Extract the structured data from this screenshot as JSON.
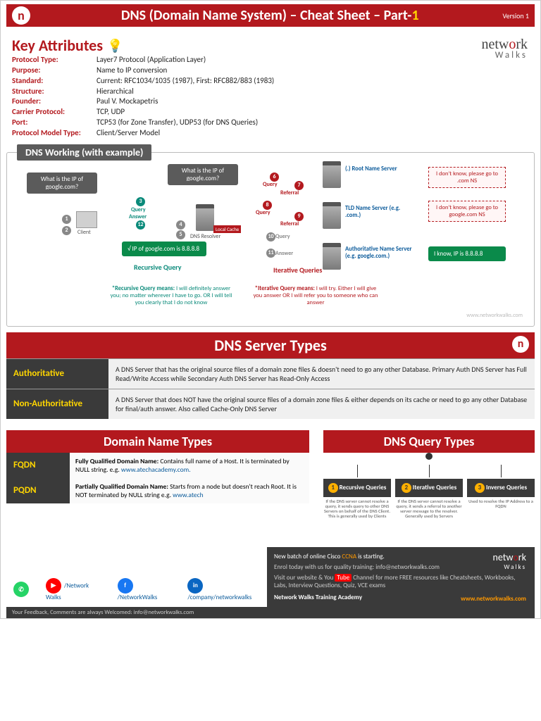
{
  "header": {
    "title_pre": "DNS (Domain Name System) – Cheat Sheet – Part-",
    "title_num": "1",
    "version": "Version 1",
    "logo_letter": "n"
  },
  "brand": {
    "name_pre": "netw",
    "name_o": "o",
    "name_post": "rk",
    "sub": "Walks"
  },
  "key_attributes": {
    "heading": "Key Attributes",
    "rows": [
      {
        "label": "Protocol Type:",
        "value": "Layer7 Protocol (Application Layer)"
      },
      {
        "label": "Purpose:",
        "value": "Name to IP conversion"
      },
      {
        "label": "Standard:",
        "value": "Current: RFC1034/1035 (1987), First: RFC882/883 (1983)"
      },
      {
        "label": "Structure:",
        "value": "Hierarchical"
      },
      {
        "label": "Founder:",
        "value": "Paul V. Mockapetris"
      },
      {
        "label": "Carrier Protocol:",
        "value": "TCP, UDP"
      },
      {
        "label": "Port:",
        "value": "TCP53 (for Zone Transfer), UDP53 (for DNS Queries)"
      },
      {
        "label": "Protocol Model Type:",
        "value": "Client/Server Model"
      }
    ]
  },
  "working": {
    "title": "DNS Working (with example)",
    "client_q": "What is the IP of google.com?",
    "resolver_q": "What is the IP of google.com?",
    "answer": "√  IP of google.com is 8.8.8.8",
    "ref_root": "I don't know, please go to .com NS",
    "ref_tld": "I don't know, please go to google.com NS",
    "ref_auth": "I know, IP is 8.8.8.8",
    "srv_root": "(.) Root Name Server",
    "srv_tld": "TLD Name Server (e.g. .com.)",
    "srv_auth": "Authoritative Name Server (e.g. google.com.)",
    "client_lbl": "Client",
    "resolver_lbl": "DNS Resolver",
    "cache_lbl": "Local Cache",
    "query_lbl": "Query",
    "answer_lbl": "Answer",
    "referral_lbl": "Referral",
    "rec_q": "Recursive Query",
    "it_q": "Iterative Queries",
    "rec_title": "*Recursive Query means:",
    "rec_desc": " I will definitely answer you; no matter wherever I have to go. OR I will tell you clearly that I do not know",
    "it_title": "*Iterative Query means:",
    "it_desc": " I will try. Either I will give you answer OR I will refer you to someone who can answer",
    "watermark": "www.networkwalks.com"
  },
  "server_types": {
    "banner": "DNS Server Types",
    "rows": [
      {
        "name": "Authoritative",
        "desc": "A DNS Server that has the original source files of a domain zone files & doesn't need to go any other Database. Primary Auth DNS Server has Full Read/Write Access while Secondary Auth DNS Server has Read-Only Access"
      },
      {
        "name": "Non-Authoritative",
        "desc": "A DNS Server that does NOT have the original source files of a domain zone files & either depends on its cache or need to go any other Database for final/auth answer. Also called Cache-Only DNS Server"
      }
    ]
  },
  "domain_types": {
    "banner": "Domain Name Types",
    "rows": [
      {
        "name": "FQDN",
        "desc_b": "Fully Qualified Domain Name:",
        "desc": " Contains full name of a Host. It is terminated by NULL string. e.g. ",
        "ex": "www.atechacademy.com."
      },
      {
        "name": "PQDN",
        "desc_b": "Partially Qualified Domain Name:",
        "desc": " Starts from a node but doesn't reach Root. It is NOT terminated by NULL string e.g. ",
        "ex": "www.atech"
      }
    ]
  },
  "query_types": {
    "banner": "DNS Query Types",
    "items": [
      {
        "num": "1",
        "name": "Recursive Queries",
        "desc": "If the DNS server cannot resolve a query, it sends query to other DNS Servers on behalf of the DNS Client. This is generally used by Clients"
      },
      {
        "num": "2",
        "name": "Iterative Queries",
        "desc": "If the DNS server cannot resolve a query, it sends a referral to another server message to the resolver. Generally used by Servers"
      },
      {
        "num": "3",
        "name": "Inverse Queries",
        "desc": "Used to resolve the IP Address to a FQDN"
      }
    ]
  },
  "footer": {
    "line1": "New batch of online Cisco CCNA is starting.",
    "line2": "Enrol today with us for quality training: info@networkwalks.com",
    "line3_pre": "Visit our website & You",
    "line3_tube": "Tube",
    "line3_post": " Channel for more FREE resources like Cheatsheets, Workbooks, Labs, Interview Questions, Quiz, VCE exams",
    "academy": "Network Walks Training Academy",
    "url": "www.networkwalks.com"
  },
  "socials": {
    "yt": "/Network Walks",
    "fb": "/NetworkWalks",
    "li": "/company/networkwalks"
  },
  "bottom": "Your Feedback, Comments are always Welcomed: info@networkwalks.com"
}
